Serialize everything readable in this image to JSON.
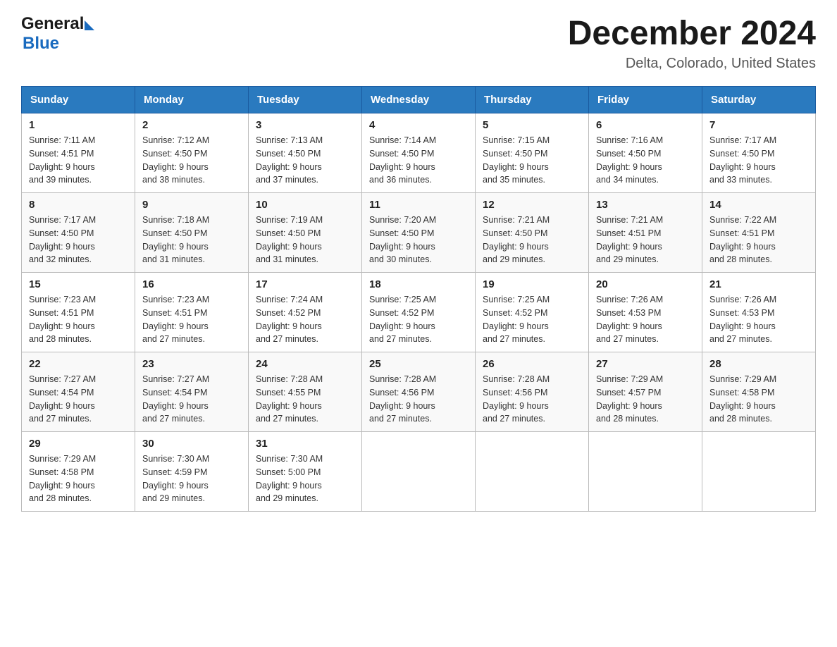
{
  "header": {
    "logo_line1": "General",
    "logo_line2": "Blue",
    "title": "December 2024",
    "subtitle": "Delta, Colorado, United States"
  },
  "weekdays": [
    "Sunday",
    "Monday",
    "Tuesday",
    "Wednesday",
    "Thursday",
    "Friday",
    "Saturday"
  ],
  "weeks": [
    [
      {
        "day": "1",
        "sunrise": "7:11 AM",
        "sunset": "4:51 PM",
        "daylight": "9 hours and 39 minutes."
      },
      {
        "day": "2",
        "sunrise": "7:12 AM",
        "sunset": "4:50 PM",
        "daylight": "9 hours and 38 minutes."
      },
      {
        "day": "3",
        "sunrise": "7:13 AM",
        "sunset": "4:50 PM",
        "daylight": "9 hours and 37 minutes."
      },
      {
        "day": "4",
        "sunrise": "7:14 AM",
        "sunset": "4:50 PM",
        "daylight": "9 hours and 36 minutes."
      },
      {
        "day": "5",
        "sunrise": "7:15 AM",
        "sunset": "4:50 PM",
        "daylight": "9 hours and 35 minutes."
      },
      {
        "day": "6",
        "sunrise": "7:16 AM",
        "sunset": "4:50 PM",
        "daylight": "9 hours and 34 minutes."
      },
      {
        "day": "7",
        "sunrise": "7:17 AM",
        "sunset": "4:50 PM",
        "daylight": "9 hours and 33 minutes."
      }
    ],
    [
      {
        "day": "8",
        "sunrise": "7:17 AM",
        "sunset": "4:50 PM",
        "daylight": "9 hours and 32 minutes."
      },
      {
        "day": "9",
        "sunrise": "7:18 AM",
        "sunset": "4:50 PM",
        "daylight": "9 hours and 31 minutes."
      },
      {
        "day": "10",
        "sunrise": "7:19 AM",
        "sunset": "4:50 PM",
        "daylight": "9 hours and 31 minutes."
      },
      {
        "day": "11",
        "sunrise": "7:20 AM",
        "sunset": "4:50 PM",
        "daylight": "9 hours and 30 minutes."
      },
      {
        "day": "12",
        "sunrise": "7:21 AM",
        "sunset": "4:50 PM",
        "daylight": "9 hours and 29 minutes."
      },
      {
        "day": "13",
        "sunrise": "7:21 AM",
        "sunset": "4:51 PM",
        "daylight": "9 hours and 29 minutes."
      },
      {
        "day": "14",
        "sunrise": "7:22 AM",
        "sunset": "4:51 PM",
        "daylight": "9 hours and 28 minutes."
      }
    ],
    [
      {
        "day": "15",
        "sunrise": "7:23 AM",
        "sunset": "4:51 PM",
        "daylight": "9 hours and 28 minutes."
      },
      {
        "day": "16",
        "sunrise": "7:23 AM",
        "sunset": "4:51 PM",
        "daylight": "9 hours and 27 minutes."
      },
      {
        "day": "17",
        "sunrise": "7:24 AM",
        "sunset": "4:52 PM",
        "daylight": "9 hours and 27 minutes."
      },
      {
        "day": "18",
        "sunrise": "7:25 AM",
        "sunset": "4:52 PM",
        "daylight": "9 hours and 27 minutes."
      },
      {
        "day": "19",
        "sunrise": "7:25 AM",
        "sunset": "4:52 PM",
        "daylight": "9 hours and 27 minutes."
      },
      {
        "day": "20",
        "sunrise": "7:26 AM",
        "sunset": "4:53 PM",
        "daylight": "9 hours and 27 minutes."
      },
      {
        "day": "21",
        "sunrise": "7:26 AM",
        "sunset": "4:53 PM",
        "daylight": "9 hours and 27 minutes."
      }
    ],
    [
      {
        "day": "22",
        "sunrise": "7:27 AM",
        "sunset": "4:54 PM",
        "daylight": "9 hours and 27 minutes."
      },
      {
        "day": "23",
        "sunrise": "7:27 AM",
        "sunset": "4:54 PM",
        "daylight": "9 hours and 27 minutes."
      },
      {
        "day": "24",
        "sunrise": "7:28 AM",
        "sunset": "4:55 PM",
        "daylight": "9 hours and 27 minutes."
      },
      {
        "day": "25",
        "sunrise": "7:28 AM",
        "sunset": "4:56 PM",
        "daylight": "9 hours and 27 minutes."
      },
      {
        "day": "26",
        "sunrise": "7:28 AM",
        "sunset": "4:56 PM",
        "daylight": "9 hours and 27 minutes."
      },
      {
        "day": "27",
        "sunrise": "7:29 AM",
        "sunset": "4:57 PM",
        "daylight": "9 hours and 28 minutes."
      },
      {
        "day": "28",
        "sunrise": "7:29 AM",
        "sunset": "4:58 PM",
        "daylight": "9 hours and 28 minutes."
      }
    ],
    [
      {
        "day": "29",
        "sunrise": "7:29 AM",
        "sunset": "4:58 PM",
        "daylight": "9 hours and 28 minutes."
      },
      {
        "day": "30",
        "sunrise": "7:30 AM",
        "sunset": "4:59 PM",
        "daylight": "9 hours and 29 minutes."
      },
      {
        "day": "31",
        "sunrise": "7:30 AM",
        "sunset": "5:00 PM",
        "daylight": "9 hours and 29 minutes."
      },
      null,
      null,
      null,
      null
    ]
  ],
  "labels": {
    "sunrise": "Sunrise:",
    "sunset": "Sunset:",
    "daylight": "Daylight:"
  }
}
